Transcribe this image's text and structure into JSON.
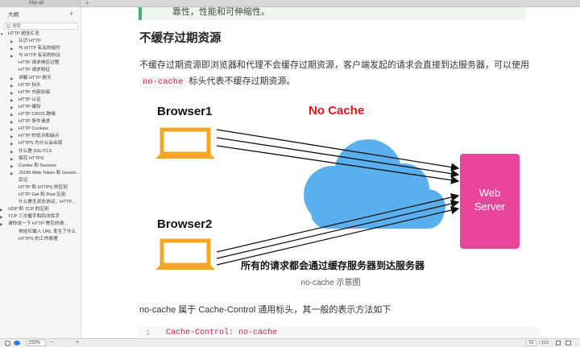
{
  "tabbar": {
    "tab_label": "http-all",
    "add_label": "+"
  },
  "sidebar": {
    "title": "大纲",
    "add_label": "+",
    "search_placeholder": "搜索",
    "items": [
      {
        "label": "HTTP 超全汇总",
        "level": 0,
        "arrow": "▼"
      },
      {
        "label": "认识 HTTP",
        "level": 1,
        "arrow": "▶"
      },
      {
        "label": "与 HTTP 有关的组件",
        "level": 1,
        "arrow": "▶"
      },
      {
        "label": "与 HTTP 有关的协议",
        "level": 1,
        "arrow": "▶"
      },
      {
        "label": "HTTP 请求响应过程",
        "level": 1,
        "arrow": ""
      },
      {
        "label": "HTTP 请求特征",
        "level": 1,
        "arrow": ""
      },
      {
        "label": "详解 HTTP 报文",
        "level": 1,
        "arrow": "▶"
      },
      {
        "label": "HTTP 标头",
        "level": 1,
        "arrow": "▶"
      },
      {
        "label": "HTTP 内容协商",
        "level": 1,
        "arrow": "▶"
      },
      {
        "label": "HTTP 认证",
        "level": 1,
        "arrow": "▶"
      },
      {
        "label": "HTTP 缓存",
        "level": 1,
        "arrow": "▶"
      },
      {
        "label": "HTTP CROS 跨域",
        "level": 1,
        "arrow": "▶"
      },
      {
        "label": "HTTP 条件请求",
        "level": 1,
        "arrow": "▶"
      },
      {
        "label": "HTTP Cookies",
        "level": 1,
        "arrow": "▶"
      },
      {
        "label": "HTTP 的优点和缺点",
        "level": 1,
        "arrow": "▶"
      },
      {
        "label": "HTTPS 为什么会出现",
        "level": 1,
        "arrow": "▶"
      },
      {
        "label": "什么是 SSL/TLS",
        "level": 1,
        "arrow": "▶"
      },
      {
        "label": "探究 HTTPS",
        "level": 1,
        "arrow": "▶"
      },
      {
        "label": "Cookie 和 Session",
        "level": 1,
        "arrow": "▶"
      },
      {
        "label": "JSON Web Token 和 Sessio...",
        "level": 1,
        "arrow": "▶"
      },
      {
        "label": "后记",
        "level": 1,
        "arrow": ""
      },
      {
        "label": "HTTP 和 HTTPS 的区别",
        "level": 1,
        "arrow": ""
      },
      {
        "label": "HTTP Get 和 Post 区别",
        "level": 1,
        "arrow": ""
      },
      {
        "label": "什么是无状态协议，HTTP...",
        "level": 1,
        "arrow": ""
      },
      {
        "label": "UDP 和 TCP 的区别",
        "level": 0,
        "arrow": "▶"
      },
      {
        "label": "TCP 三次握手和四次挥手",
        "level": 0,
        "arrow": "▶"
      },
      {
        "label": "请你说一下 HTTP 常见的请...",
        "level": 0,
        "arrow": "▶"
      },
      {
        "label": "地址栏输入 URL 发生了什么",
        "level": 1,
        "arrow": ""
      },
      {
        "label": "HTTPS 的工作原理",
        "level": 1,
        "arrow": ""
      }
    ]
  },
  "main": {
    "quote_text": "靠性，性能和可伸缩性。",
    "heading": "不缓存过期资源",
    "para_before": "不缓存过期资源即浏览器和代理不会缓存过期资源，客户端发起的请求会直接到达服务器，可以使用",
    "inline_code": "no-cache",
    "para_after": "标头代表不缓存过期资源。",
    "figure": {
      "browser1": "Browser1",
      "browser2": "Browser2",
      "no_cache": "No Cache",
      "server_line1": "Web",
      "server_line2": "Server",
      "note": "所有的请求都会通过缓存服务器到达服务器"
    },
    "caption": "no-cache 示意图",
    "para2": "no-cache 属于 Cache-Control 通用标头，其一般的表示方法如下",
    "code_line_number": "1",
    "code_text": "Cache-Control: no-cache"
  },
  "statusbar": {
    "zoom": "232%",
    "zoom_minus": "−",
    "zoom_plus": "+",
    "page_current": "52",
    "page_total": "/ 122"
  },
  "colors": {
    "accent": "#2f7fd8",
    "quote_border": "#3cb371",
    "laptop": "#f5a623",
    "cloud": "#5ab0ee",
    "server": "#e8459b",
    "no_cache_red": "#e0141e",
    "code_red": "#c7254e"
  }
}
